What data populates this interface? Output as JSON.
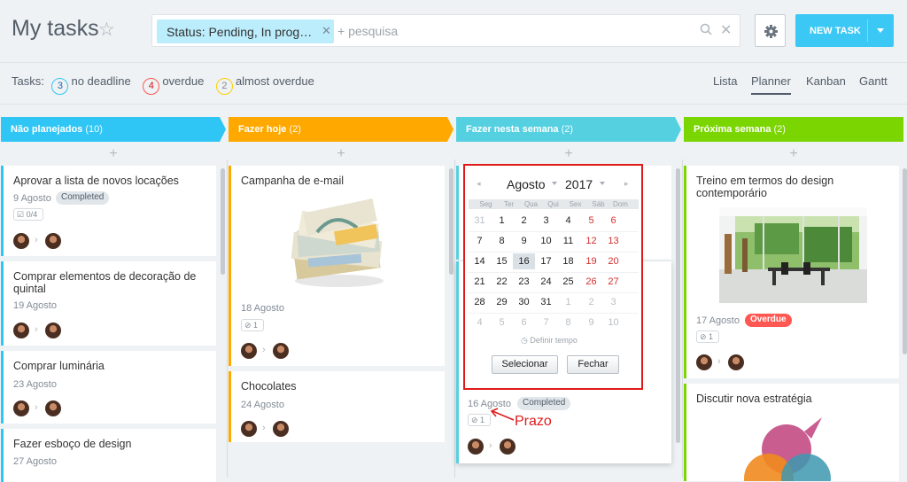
{
  "header": {
    "title": "My tasks",
    "filter_chip": "Status: Pending, In prog…",
    "search_placeholder": "+ pesquisa",
    "new_task_label": "NEW TASK"
  },
  "counters": {
    "label": "Tasks:",
    "items": [
      {
        "count": "3",
        "label": "no deadline"
      },
      {
        "count": "4",
        "label": "overdue"
      },
      {
        "count": "2",
        "label": "almost overdue"
      }
    ]
  },
  "views": [
    "Lista",
    "Planner",
    "Kanban",
    "Gantt"
  ],
  "active_view": "Planner",
  "stages": [
    {
      "name": "Não planejados",
      "count": "(10)",
      "color": "#2fc6f6"
    },
    {
      "name": "Fazer hoje",
      "count": "(2)",
      "color": "#ffa900"
    },
    {
      "name": "Fazer nesta semana",
      "count": "(2)",
      "color": "#55d0e0"
    },
    {
      "name": "Próxima semana",
      "count": "(2)",
      "color": "#7bd500"
    }
  ],
  "plus": "+",
  "col1": [
    {
      "title": "Aprovar a lista de novos locações",
      "date": "9 Agosto",
      "badge": "Completed",
      "checklist": "0/4"
    },
    {
      "title": "Comprar elementos de decoração de quintal",
      "date": "19 Agosto"
    },
    {
      "title": "Comprar luminária",
      "date": "23 Agosto"
    },
    {
      "title": "Fazer esboço de design",
      "date": "27 Agosto"
    }
  ],
  "col2": [
    {
      "title": "Campanha de e-mail",
      "date": "18 Agosto",
      "files": "1"
    },
    {
      "title": "Chocolates",
      "date": "24 Agosto"
    }
  ],
  "col3": [
    {
      "date": "16 Agosto",
      "badge": "Completed",
      "files": "1"
    }
  ],
  "col4": [
    {
      "title": "Treino em termos do design contemporário",
      "date": "17 Agosto",
      "badge": "Overdue",
      "files": "1"
    },
    {
      "title": "Discutir nova estratégia"
    }
  ],
  "calendar": {
    "month": "Agosto",
    "year": "2017",
    "weekdays": [
      "Seg",
      "Ter",
      "Qua",
      "Qui",
      "Sex",
      "Sáb",
      "Dom"
    ],
    "weeks": [
      [
        "31",
        "1",
        "2",
        "3",
        "4",
        "5",
        "6"
      ],
      [
        "7",
        "8",
        "9",
        "10",
        "11",
        "12",
        "13"
      ],
      [
        "14",
        "15",
        "16",
        "17",
        "18",
        "19",
        "20"
      ],
      [
        "21",
        "22",
        "23",
        "24",
        "25",
        "26",
        "27"
      ],
      [
        "28",
        "29",
        "30",
        "31",
        "1",
        "2",
        "3"
      ],
      [
        "4",
        "5",
        "6",
        "7",
        "8",
        "9",
        "10"
      ]
    ],
    "today": "16",
    "time_label": "Definir tempo",
    "select_label": "Selecionar",
    "close_label": "Fechar"
  },
  "annotation": "Prazo",
  "colors": {
    "accent": "#3bc8f5",
    "annotation": "#e01a1a"
  }
}
